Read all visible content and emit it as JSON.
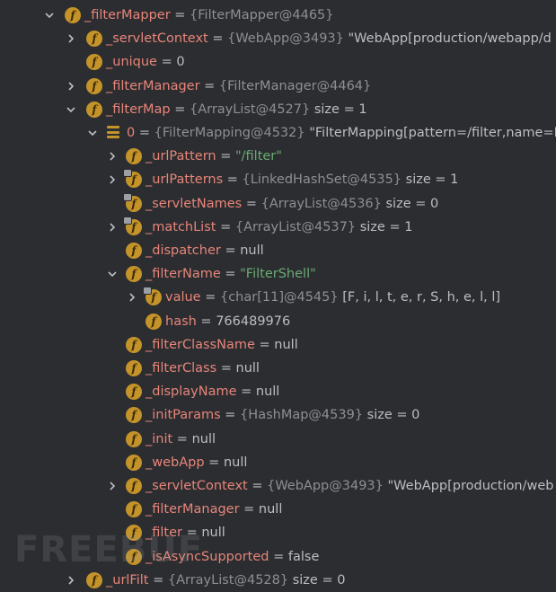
{
  "tree": [
    {
      "depth": 0,
      "arrow": "expanded",
      "icon": "field",
      "name": "_filterMapper",
      "eq": " = ",
      "ref": "{FilterMapper@4465}",
      "value": ""
    },
    {
      "depth": 1,
      "arrow": "collapsed",
      "icon": "field",
      "name": "_servletContext",
      "eq": " = ",
      "ref": "{WebApp@3493}",
      "value": " \"WebApp[production/webapp/d"
    },
    {
      "depth": 1,
      "arrow": "none",
      "icon": "field",
      "name": "_unique",
      "eq": " = ",
      "ref": "",
      "value": "0"
    },
    {
      "depth": 1,
      "arrow": "collapsed",
      "icon": "field",
      "name": "_filterManager",
      "eq": " = ",
      "ref": "{FilterManager@4464}",
      "value": ""
    },
    {
      "depth": 1,
      "arrow": "expanded",
      "icon": "field",
      "name": "_filterMap",
      "eq": " = ",
      "ref": "{ArrayList@4527}",
      "value": "  size = 1"
    },
    {
      "depth": 2,
      "arrow": "expanded",
      "icon": "array",
      "name": "0",
      "eq": " = ",
      "ref": "{FilterMapping@4532}",
      "value": " \"FilterMapping[pattern=/filter,name=F"
    },
    {
      "depth": 3,
      "arrow": "collapsed",
      "icon": "field",
      "name": "_urlPattern",
      "eq": " = ",
      "ref": "",
      "value": "\"/filter\"",
      "string": true
    },
    {
      "depth": 3,
      "arrow": "collapsed",
      "icon": "field-locked",
      "name": "_urlPatterns",
      "eq": " = ",
      "ref": "{LinkedHashSet@4535}",
      "value": "  size = 1"
    },
    {
      "depth": 3,
      "arrow": "none",
      "icon": "field-locked",
      "name": "_servletNames",
      "eq": " = ",
      "ref": "{ArrayList@4536}",
      "value": "  size = 0"
    },
    {
      "depth": 3,
      "arrow": "collapsed",
      "icon": "field-locked",
      "name": "_matchList",
      "eq": " = ",
      "ref": "{ArrayList@4537}",
      "value": "  size = 1"
    },
    {
      "depth": 3,
      "arrow": "none",
      "icon": "field",
      "name": "_dispatcher",
      "eq": " = ",
      "ref": "",
      "value": "null"
    },
    {
      "depth": 3,
      "arrow": "expanded",
      "icon": "field",
      "name": "_filterName",
      "eq": " = ",
      "ref": "",
      "value": "\"FilterShell\"",
      "string": true
    },
    {
      "depth": 4,
      "arrow": "collapsed",
      "icon": "field-locked",
      "name": "value",
      "eq": " = ",
      "ref": "{char[11]@4545}",
      "value": " [F, i, l, t, e, r, S, h, e, l, l]"
    },
    {
      "depth": 4,
      "arrow": "none",
      "icon": "field",
      "name": "hash",
      "eq": " = ",
      "ref": "",
      "value": "766489976"
    },
    {
      "depth": 3,
      "arrow": "none",
      "icon": "field",
      "name": "_filterClassName",
      "eq": " = ",
      "ref": "",
      "value": "null"
    },
    {
      "depth": 3,
      "arrow": "none",
      "icon": "field",
      "name": "_filterClass",
      "eq": " = ",
      "ref": "",
      "value": "null"
    },
    {
      "depth": 3,
      "arrow": "none",
      "icon": "field",
      "name": "_displayName",
      "eq": " = ",
      "ref": "",
      "value": "null"
    },
    {
      "depth": 3,
      "arrow": "none",
      "icon": "field",
      "name": "_initParams",
      "eq": " = ",
      "ref": "{HashMap@4539}",
      "value": "  size = 0"
    },
    {
      "depth": 3,
      "arrow": "none",
      "icon": "field",
      "name": "_init",
      "eq": " = ",
      "ref": "",
      "value": "null"
    },
    {
      "depth": 3,
      "arrow": "none",
      "icon": "field",
      "name": "_webApp",
      "eq": " = ",
      "ref": "",
      "value": "null"
    },
    {
      "depth": 3,
      "arrow": "collapsed",
      "icon": "field",
      "name": "_servletContext",
      "eq": " = ",
      "ref": "{WebApp@3493}",
      "value": " \"WebApp[production/web"
    },
    {
      "depth": 3,
      "arrow": "none",
      "icon": "field",
      "name": "_filterManager",
      "eq": " = ",
      "ref": "",
      "value": "null"
    },
    {
      "depth": 3,
      "arrow": "none",
      "icon": "field",
      "name": "_filter",
      "eq": " = ",
      "ref": "",
      "value": "null"
    },
    {
      "depth": 3,
      "arrow": "none",
      "icon": "field",
      "name": "_isAsyncSupported",
      "eq": " = ",
      "ref": "",
      "value": "false"
    },
    {
      "depth": 1,
      "arrow": "collapsed",
      "icon": "field",
      "name": "_urlFilt",
      "eq": " = ",
      "ref": "{ArrayList@4528}",
      "value": "  size = 0"
    }
  ],
  "watermark": "FREEBUF",
  "colors": {
    "background": "#2b2d30",
    "field_name": "#e8857a",
    "string_value": "#6aab73",
    "reference": "#8c8f94",
    "plain_value": "#bcbec4",
    "field_icon": "#c4932a"
  },
  "icon_names": {
    "expanded": "chevron-down-icon",
    "collapsed": "chevron-right-icon",
    "field": "field-icon",
    "field-locked": "field-locked-icon",
    "array": "array-element-icon"
  }
}
